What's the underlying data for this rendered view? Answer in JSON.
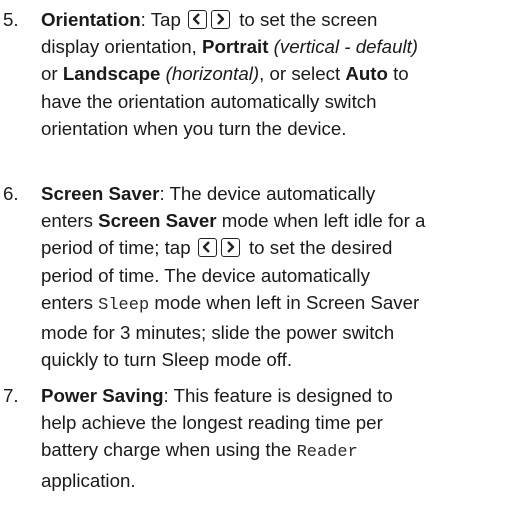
{
  "items": [
    {
      "number": "5.",
      "term": "Orientation",
      "lines": {
        "l1_a": ": Tap ",
        "l1_b": " to set the screen",
        "l2": "display orientation, ",
        "l2_bold": "Portrait",
        "l2_italic": " (vertical - default)",
        "l3_pre": "or ",
        "l3_bold1": "Landscape",
        "l3_italic": " (horizontal)",
        "l3_mid": ", or select ",
        "l3_bold2": "Auto",
        "l3_post": " to",
        "l4": "have the orientation automatically switch",
        "l5": "orientation when you turn the device."
      }
    },
    {
      "number": "6.",
      "term": "Screen Saver",
      "lines": {
        "l1": ": The device automatically",
        "l2_pre": "enters ",
        "l2_bold": "Screen Saver",
        "l2_post": " mode when left idle for a",
        "l3_a": "period of time; tap ",
        "l3_b": " to set the desired",
        "l4": "period of time. The device automatically",
        "l5_pre": "enters ",
        "l5_mono": "Sleep",
        "l5_post": " mode when left in Screen Saver",
        "l6": "mode for 3 minutes; slide the power switch",
        "l7": "quickly to turn Sleep mode off."
      }
    },
    {
      "number": "7.",
      "term": "Power Saving",
      "lines": {
        "l1": ": This feature is designed to",
        "l2": "help achieve the longest reading time per",
        "l3_pre": "battery charge when using the ",
        "l3_mono": "Reader",
        "l4": "application."
      }
    }
  ],
  "icons": {
    "left": "chevron-left-icon",
    "right": "chevron-right-icon"
  }
}
